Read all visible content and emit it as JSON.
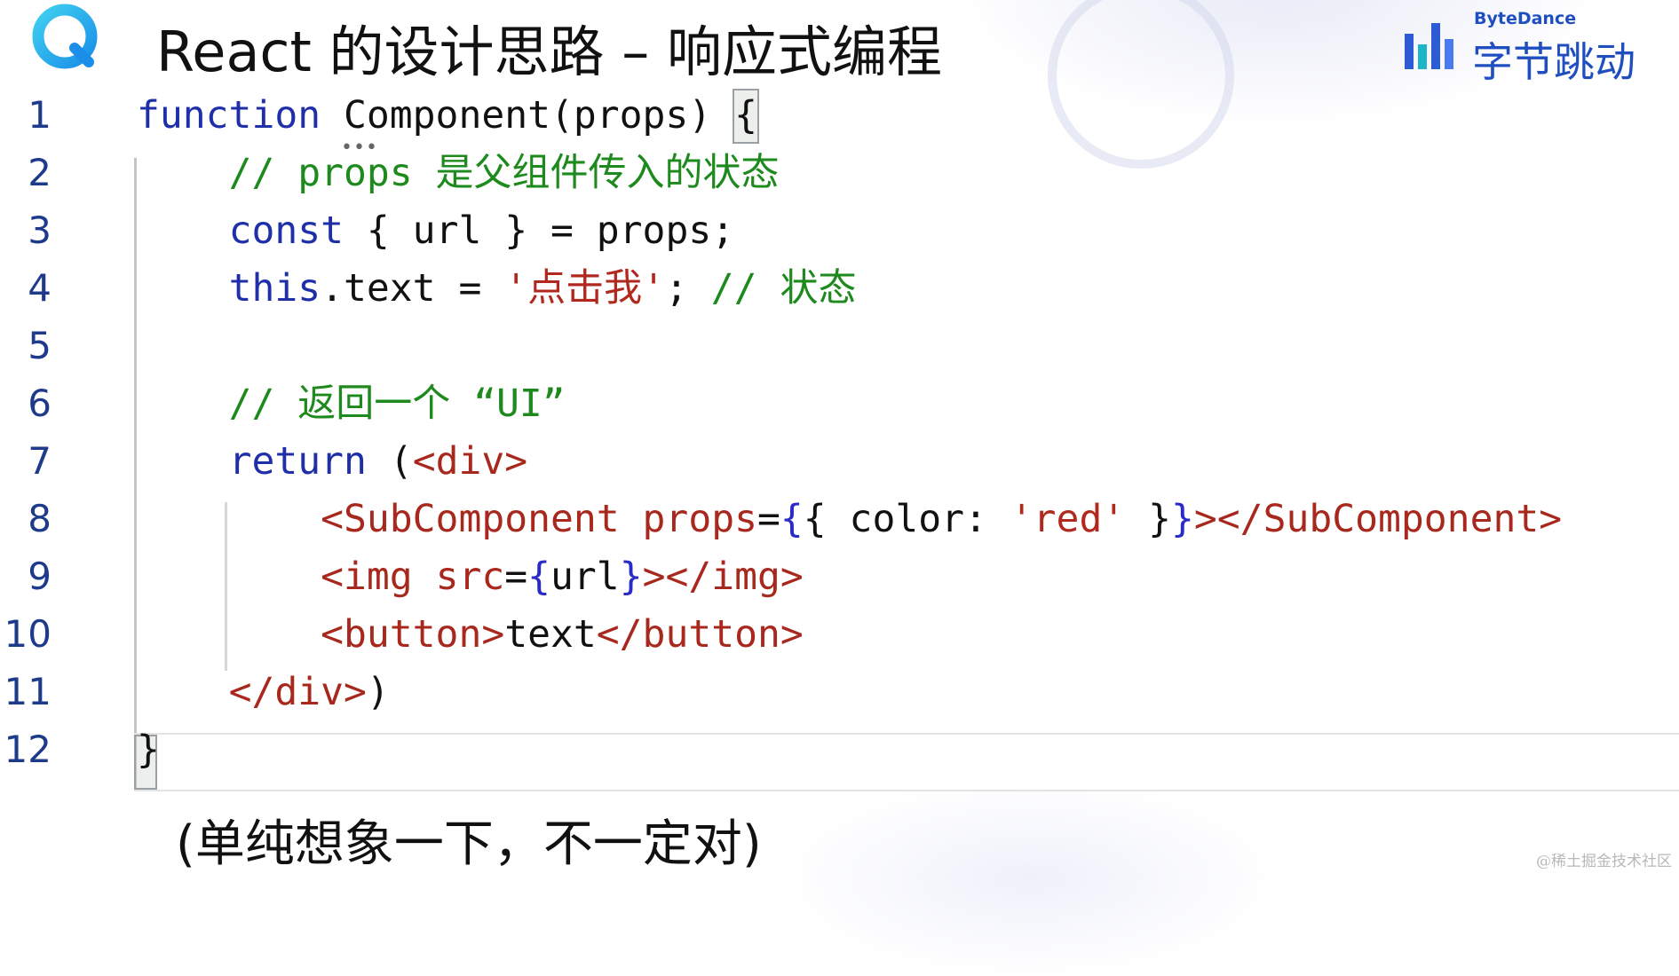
{
  "header": {
    "title": "React 的设计思路 – 响应式编程",
    "logo_icon": "app-logo-icon",
    "brand": {
      "name_en": "ByteDance",
      "name_cn": "字节跳动",
      "icon": "bytedance-bars-icon",
      "color": "#1f4fbf"
    }
  },
  "editor": {
    "lines": [
      {
        "number": "1",
        "tokens": [
          {
            "t": "function",
            "c": "kw"
          },
          {
            "t": " Component(props) ",
            "c": "text"
          },
          {
            "t": "{",
            "c": "text"
          }
        ]
      },
      {
        "number": "2",
        "tokens": [
          {
            "t": "    ",
            "c": "text"
          },
          {
            "t": "// props 是父组件传入的状态",
            "c": "cm"
          }
        ]
      },
      {
        "number": "3",
        "tokens": [
          {
            "t": "    ",
            "c": "text"
          },
          {
            "t": "const",
            "c": "kw"
          },
          {
            "t": " { url } = props;",
            "c": "text"
          }
        ]
      },
      {
        "number": "4",
        "tokens": [
          {
            "t": "    ",
            "c": "text"
          },
          {
            "t": "this",
            "c": "kw"
          },
          {
            "t": ".text = ",
            "c": "text"
          },
          {
            "t": "'点击我'",
            "c": "str"
          },
          {
            "t": "; ",
            "c": "text"
          },
          {
            "t": "// 状态",
            "c": "cm"
          }
        ]
      },
      {
        "number": "5",
        "tokens": []
      },
      {
        "number": "6",
        "tokens": [
          {
            "t": "    ",
            "c": "text"
          },
          {
            "t": "// 返回一个 “UI”",
            "c": "cm"
          }
        ]
      },
      {
        "number": "7",
        "tokens": [
          {
            "t": "    ",
            "c": "text"
          },
          {
            "t": "return",
            "c": "kw"
          },
          {
            "t": " (",
            "c": "text"
          },
          {
            "t": "<div>",
            "c": "tag"
          }
        ]
      },
      {
        "number": "8",
        "tokens": [
          {
            "t": "        ",
            "c": "text"
          },
          {
            "t": "<SubComponent ",
            "c": "tag"
          },
          {
            "t": "props",
            "c": "attr"
          },
          {
            "t": "=",
            "c": "text"
          },
          {
            "t": "{",
            "c": "brace"
          },
          {
            "t": "{ color: ",
            "c": "text"
          },
          {
            "t": "'red'",
            "c": "str"
          },
          {
            "t": " }",
            "c": "text"
          },
          {
            "t": "}",
            "c": "brace"
          },
          {
            "t": "></SubComponent>",
            "c": "tag"
          }
        ]
      },
      {
        "number": "9",
        "tokens": [
          {
            "t": "        ",
            "c": "text"
          },
          {
            "t": "<img ",
            "c": "tag"
          },
          {
            "t": "src",
            "c": "attr"
          },
          {
            "t": "=",
            "c": "text"
          },
          {
            "t": "{",
            "c": "brace"
          },
          {
            "t": "url",
            "c": "text"
          },
          {
            "t": "}",
            "c": "brace"
          },
          {
            "t": "></img>",
            "c": "tag"
          }
        ]
      },
      {
        "number": "10",
        "tokens": [
          {
            "t": "        ",
            "c": "text"
          },
          {
            "t": "<button>",
            "c": "tag"
          },
          {
            "t": "text",
            "c": "text"
          },
          {
            "t": "</button>",
            "c": "tag"
          }
        ]
      },
      {
        "number": "11",
        "tokens": [
          {
            "t": "    ",
            "c": "text"
          },
          {
            "t": "</div>",
            "c": "tag"
          },
          {
            "t": ")",
            "c": "text"
          }
        ]
      },
      {
        "number": "12",
        "tokens": [
          {
            "t": "}",
            "c": "text"
          }
        ]
      }
    ],
    "hint_dots": "•••",
    "colors": {
      "keyword": "#1f2fa8",
      "string": "#b1281e",
      "comment": "#1e8a1e",
      "tag": "#a8281e",
      "line_number": "#1e3a8a"
    }
  },
  "footnote": "(单纯想象一下，不一定对)",
  "watermark": "@稀土掘金技术社区"
}
